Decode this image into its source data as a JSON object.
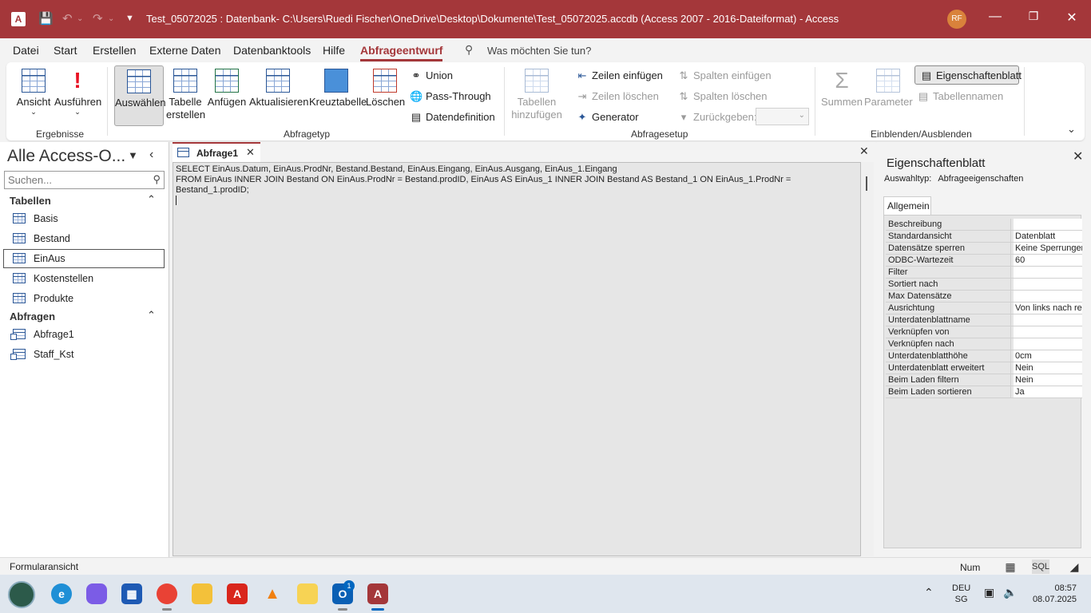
{
  "window": {
    "title": "Test_05072025 : Datenbank- C:\\Users\\Ruedi Fischer\\OneDrive\\Desktop\\Dokumente\\Test_05072025.accdb (Access 2007 - 2016-Dateiformat)  -  Access",
    "user_initials": "RF",
    "accent_color": "#a4373a"
  },
  "menu": {
    "tabs": [
      "Datei",
      "Start",
      "Erstellen",
      "Externe Daten",
      "Datenbanktools",
      "Hilfe",
      "Abfrageentwurf"
    ],
    "active_tab": "Abfrageentwurf",
    "tell_me_placeholder": "Was möchten Sie tun?"
  },
  "ribbon": {
    "ergebnisse": {
      "label": "Ergebnisse",
      "ansicht": "Ansicht",
      "ausfuehren": "Ausführen"
    },
    "abfragetyp": {
      "label": "Abfragetyp",
      "auswaehlen": "Auswählen",
      "tabelle_erstellen_1": "Tabelle",
      "tabelle_erstellen_2": "erstellen",
      "anfuegen": "Anfügen",
      "aktualisieren": "Aktualisieren",
      "kreuztabelle": "Kreuztabelle",
      "loeschen": "Löschen",
      "union": "Union",
      "pass_through": "Pass-Through",
      "datendefinition": "Datendefinition"
    },
    "abfragesetup": {
      "label": "Abfragesetup",
      "tabellen_hinzufuegen_1": "Tabellen",
      "tabellen_hinzufuegen_2": "hinzufügen",
      "zeilen_einfuegen": "Zeilen einfügen",
      "zeilen_loeschen": "Zeilen löschen",
      "generator": "Generator",
      "spalten_einfuegen": "Spalten einfügen",
      "spalten_loeschen": "Spalten löschen",
      "zurueckgeben": "Zurückgeben:"
    },
    "einblenden": {
      "label": "Einblenden/Ausblenden",
      "summen": "Summen",
      "parameter": "Parameter",
      "eigenschaftenblatt": "Eigenschaftenblatt",
      "tabellennamen": "Tabellennamen"
    }
  },
  "nav": {
    "title": "Alle Access-O...",
    "search_placeholder": "Suchen...",
    "sections": [
      {
        "label": "Tabellen",
        "items": [
          "Basis",
          "Bestand",
          "EinAus",
          "Kostenstellen",
          "Produkte"
        ]
      },
      {
        "label": "Abfragen",
        "items": [
          "Abfrage1",
          "Staff_Kst"
        ]
      }
    ],
    "selected_item": "EinAus"
  },
  "document": {
    "tab_label": "Abfrage1",
    "sql_text": "SELECT EinAus.Datum, EinAus.ProdNr, Bestand.Bestand, EinAus.Eingang, EinAus.Ausgang, EinAus_1.Eingang\nFROM EinAus INNER JOIN Bestand ON EinAus.ProdNr = Bestand.prodID, EinAus AS EinAus_1 INNER JOIN Bestand AS Bestand_1 ON EinAus_1.ProdNr =\nBestand_1.prodID;"
  },
  "property_sheet": {
    "title": "Eigenschaftenblatt",
    "selection_type_label": "Auswahltyp:",
    "selection_type_value": "Abfrageeigenschaften",
    "tab": "Allgemein",
    "rows": [
      {
        "key": "Beschreibung",
        "value": ""
      },
      {
        "key": "Standardansicht",
        "value": "Datenblatt"
      },
      {
        "key": "Datensätze sperren",
        "value": "Keine Sperrungen"
      },
      {
        "key": "ODBC-Wartezeit",
        "value": "60"
      },
      {
        "key": "Filter",
        "value": ""
      },
      {
        "key": "Sortiert nach",
        "value": ""
      },
      {
        "key": "Max Datensätze",
        "value": ""
      },
      {
        "key": "Ausrichtung",
        "value": "Von links nach rechts"
      },
      {
        "key": "Unterdatenblattname",
        "value": ""
      },
      {
        "key": "Verknüpfen von",
        "value": ""
      },
      {
        "key": "Verknüpfen nach",
        "value": ""
      },
      {
        "key": "Unterdatenblatthöhe",
        "value": "0cm"
      },
      {
        "key": "Unterdatenblatt erweitert",
        "value": "Nein"
      },
      {
        "key": "Beim Laden filtern",
        "value": "Nein"
      },
      {
        "key": "Beim Laden sortieren",
        "value": "Ja"
      }
    ]
  },
  "statusbar": {
    "status_text": "Formularansicht",
    "num_indicator": "Num",
    "sql_view_label": "SQL"
  },
  "taskbar": {
    "apps": [
      "start-orb",
      "edge",
      "copilot",
      "store",
      "chrome",
      "file-explorer",
      "acrobat",
      "vlc",
      "notes",
      "outlook",
      "access"
    ],
    "outlook_badge": "1",
    "lang_top": "DEU",
    "lang_bottom": "SG",
    "time": "08:57",
    "date": "08.07.2025"
  }
}
